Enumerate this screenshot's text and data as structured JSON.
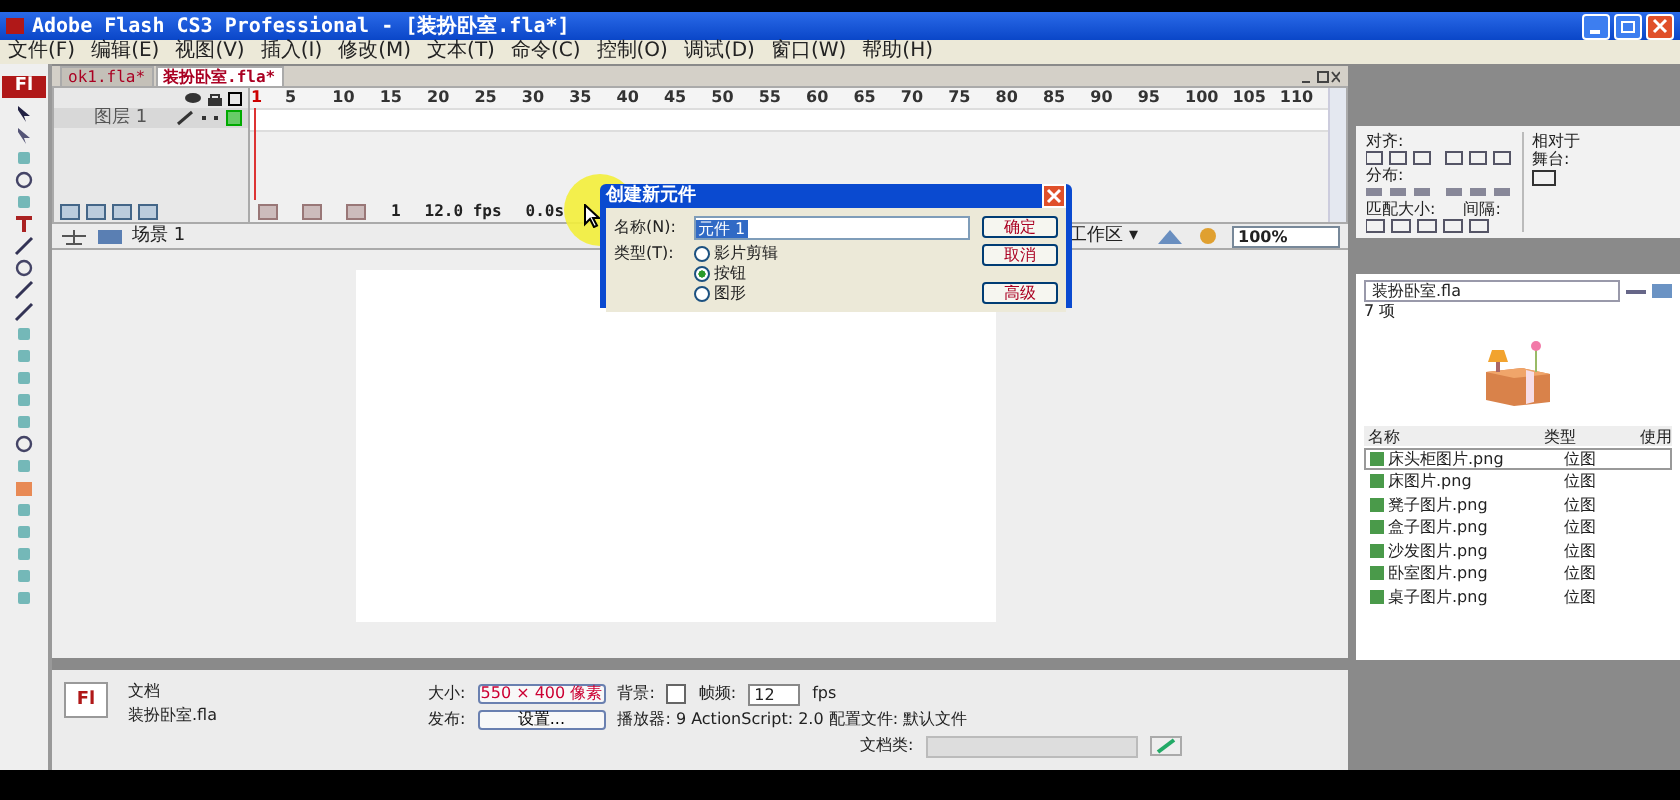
{
  "window": {
    "title": "Adobe Flash CS3 Professional - [装扮卧室.fla*]"
  },
  "menu": [
    "文件(F)",
    "编辑(E)",
    "视图(V)",
    "插入(I)",
    "修改(M)",
    "文本(T)",
    "命令(C)",
    "控制(O)",
    "调试(D)",
    "窗口(W)",
    "帮助(H)"
  ],
  "toolbar": {
    "logo": "Fl"
  },
  "doc_tabs": [
    {
      "label": "ok1.fla*",
      "selected": false
    },
    {
      "label": "装扮卧室.fla*",
      "selected": true
    }
  ],
  "timeline": {
    "frames": [
      "1",
      "5",
      "10",
      "15",
      "20",
      "25",
      "30",
      "35",
      "40",
      "45",
      "50",
      "55",
      "60",
      "65",
      "70",
      "75",
      "80",
      "85",
      "90",
      "95",
      "100",
      "105",
      "110"
    ],
    "layer": "图层 1",
    "current_frame": "1",
    "frame_rate": "12.0 fps",
    "elapsed": "0.0s"
  },
  "edit_bar": {
    "scene": "场景 1",
    "workspace": "工作区 ▾",
    "zoom": "100%"
  },
  "dialog": {
    "title": "创建新元件",
    "name_label": "名称(N):",
    "name_value": "元件 1",
    "type_label": "类型(T):",
    "types": [
      {
        "label": "影片剪辑",
        "selected": false
      },
      {
        "label": "按钮",
        "selected": true
      },
      {
        "label": "图形",
        "selected": false
      }
    ],
    "buttons": [
      "确定",
      "取消",
      "高级"
    ]
  },
  "align_panel": {
    "align": "对齐:",
    "distribute": "分布:",
    "match_size": "匹配大小:",
    "spacing": "间隔:",
    "relative": "相对于",
    "stage": "舞台:"
  },
  "library": {
    "document": "装扮卧室.fla",
    "count": "7 项",
    "columns": [
      "名称",
      "类型",
      "使用"
    ],
    "items": [
      {
        "name": "床头柜图片.png",
        "type": "位图",
        "selected": true
      },
      {
        "name": "床图片.png",
        "type": "位图",
        "selected": false
      },
      {
        "name": "凳子图片.png",
        "type": "位图",
        "selected": false
      },
      {
        "name": "盒子图片.png",
        "type": "位图",
        "selected": false
      },
      {
        "name": "沙发图片.png",
        "type": "位图",
        "selected": false
      },
      {
        "name": "卧室图片.png",
        "type": "位图",
        "selected": false
      },
      {
        "name": "桌子图片.png",
        "type": "位图",
        "selected": false
      }
    ]
  },
  "properties": {
    "logo": "Fl",
    "kind": "文档",
    "file": "装扮卧室.fla",
    "size_label": "大小:",
    "size_value": "550 × 400 像素",
    "background_label": "背景:",
    "frame_rate_label": "帧频:",
    "frame_rate_value": "12",
    "fps": "fps",
    "publish_label": "发布:",
    "settings": "设置...",
    "player": "播放器:  9   ActionScript:  2.0   配置文件: 默认文件",
    "doc_class_label": "文档类:"
  }
}
